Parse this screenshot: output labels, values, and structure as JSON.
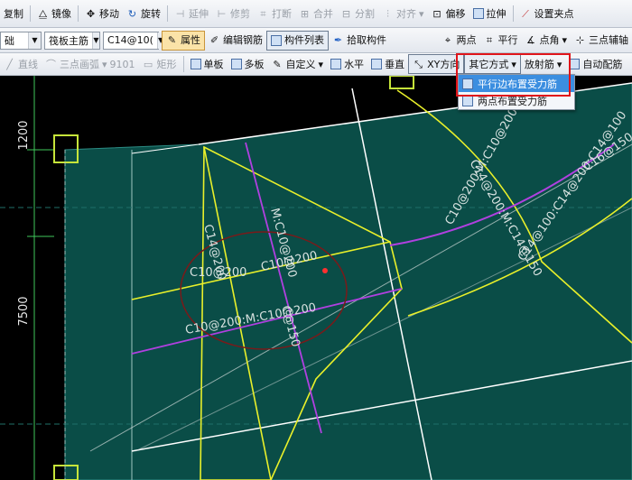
{
  "toolbar1": {
    "copy": "复制",
    "mirror": "镜像",
    "move": "移动",
    "rotate": "旋转",
    "extend": "延伸",
    "trim": "修剪",
    "break": "打断",
    "merge": "合并",
    "split": "分割",
    "align": "对齐",
    "offset": "偏移",
    "stretch": "拉伸",
    "set_grip": "设置夹点"
  },
  "toolbar2": {
    "layer_combo": "础",
    "type_combo": "筏板主筋",
    "spec_combo": "C14@10(",
    "properties": "属性",
    "edit_rebar": "编辑钢筋",
    "component_list": "构件列表",
    "pick_component": "拾取构件",
    "two_points": "两点",
    "parallel": "平行",
    "point_angle": "点角",
    "three_point_axis": "三点辅轴"
  },
  "toolbar3": {
    "line": "直线",
    "three_point_arc": "三点画弧",
    "arc_value": "9101",
    "rectangle": "矩形",
    "single_slab": "单板",
    "multi_slab": "多板",
    "custom": "自定义",
    "horizontal": "水平",
    "vertical": "垂直",
    "xy_direction": "XY方向",
    "other_method": "其它方式",
    "radial_rebar": "放射筋",
    "auto_rebar": "自动配筋"
  },
  "dropdown": {
    "items": [
      "平行边布置受力筋",
      "两点布置受力筋"
    ],
    "selected_index": 0
  },
  "canvas": {
    "dim_top": "1200",
    "dim_left": "7500",
    "rebar_labels": {
      "c10_200_a": "C10@200",
      "c10_200_b": "C10@200",
      "c14_200": "C14@200",
      "m_c10_200": "M:C10@200",
      "m_c10_200_b": "C10@200:M:C10@200",
      "c_150": "C@150",
      "c10_200_m": "C10@200:M:C10@200",
      "m_c14_150": "C14@200:M:C14@150",
      "c14_100": "C14@100:C14@200:C14@100",
      "c16_150": "C16@150"
    }
  },
  "colors": {
    "canvas_bg": "#003b36",
    "rebar_yellow": "#e9f02a",
    "rebar_magenta": "#b040e0",
    "outline_white": "#ffffff",
    "highlight_red": "#e0141a"
  }
}
